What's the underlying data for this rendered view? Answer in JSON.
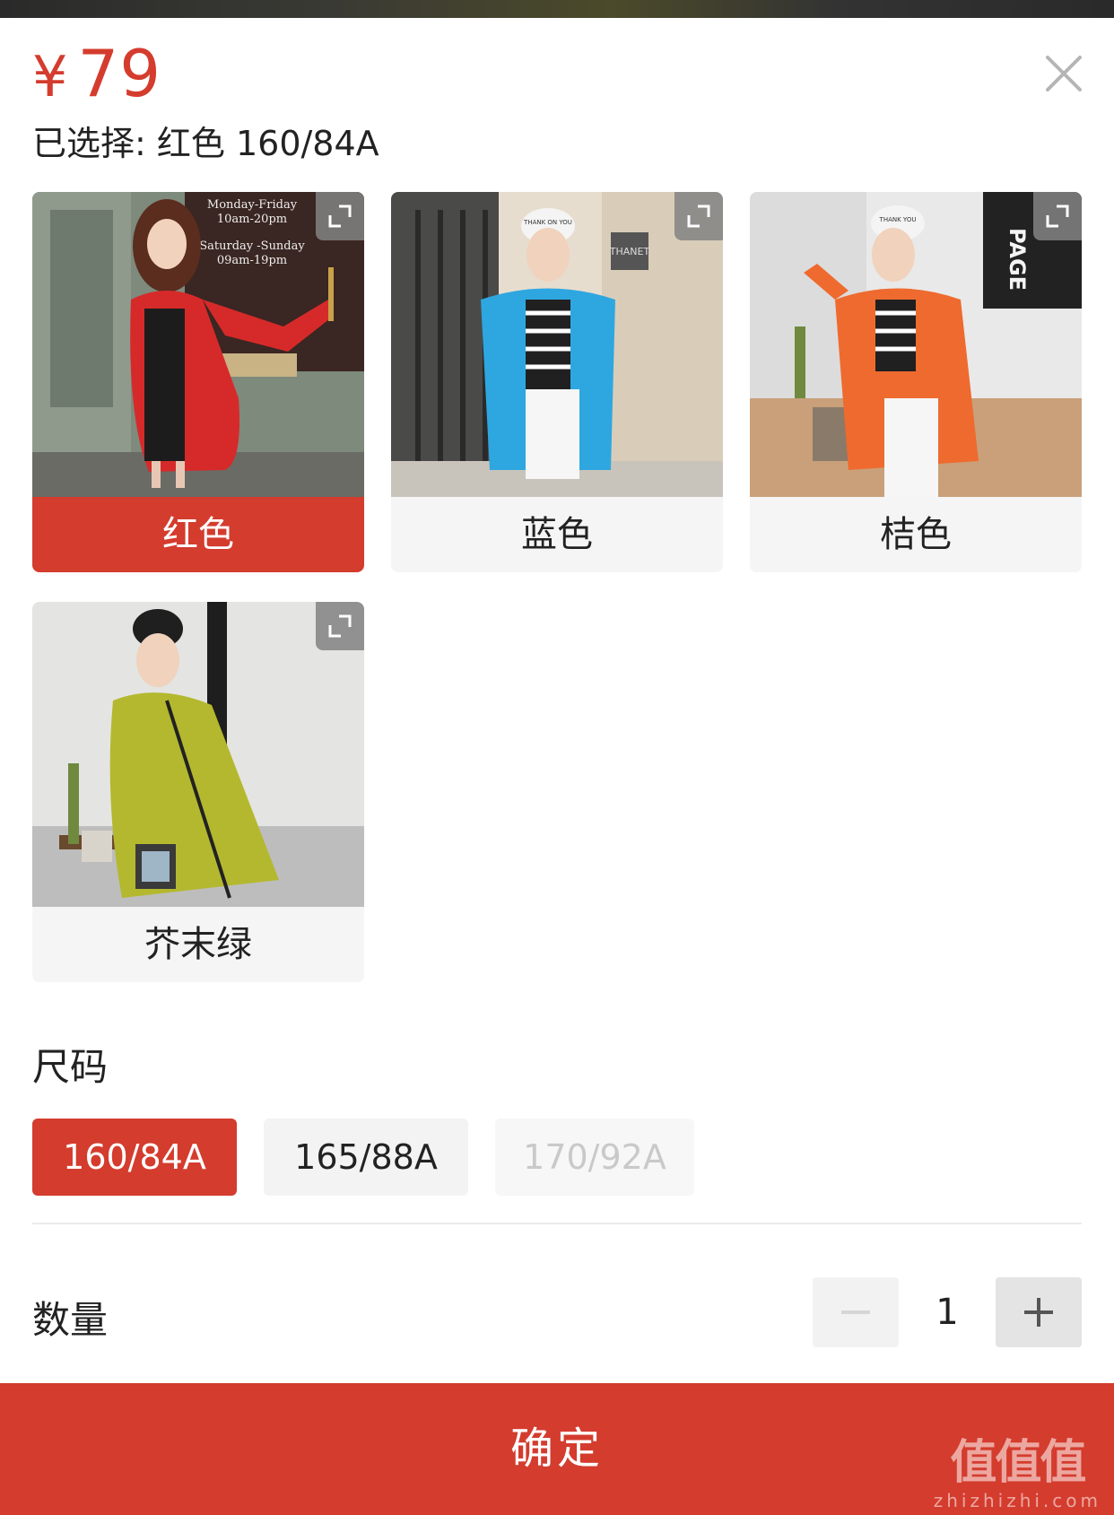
{
  "header": {
    "currency": "¥",
    "price": "79",
    "selected_text": "已选择: 红色 160/84A"
  },
  "colors": {
    "options": [
      {
        "label": "红色",
        "selected": true,
        "coat": "#d62a2a"
      },
      {
        "label": "蓝色",
        "selected": false,
        "coat": "#2ea7e0"
      },
      {
        "label": "桔色",
        "selected": false,
        "coat": "#ef6a2e"
      },
      {
        "label": "芥末绿",
        "selected": false,
        "coat": "#b4b82e"
      }
    ]
  },
  "photo_text": {
    "red_sign": [
      "Monday-Friday",
      "10am-20pm",
      "Saturday -Sunday",
      "09am-19pm"
    ],
    "blue_cap": "THANK ON YOU",
    "blue_plate": "THANET",
    "orange_wall": "PAGE",
    "orange_cap": "THANK YOU"
  },
  "size": {
    "title": "尺码",
    "options": [
      {
        "label": "160/84A",
        "state": "selected"
      },
      {
        "label": "165/88A",
        "state": "normal"
      },
      {
        "label": "170/92A",
        "state": "disabled"
      }
    ]
  },
  "quantity": {
    "label": "数量",
    "value": "1",
    "minus_icon": "minus-icon",
    "plus_icon": "plus-icon"
  },
  "confirm": {
    "label": "确定"
  },
  "watermark": {
    "big": "值值值",
    "small": "zhizhizhi.com"
  },
  "theme": {
    "accent": "#d43c2e"
  }
}
